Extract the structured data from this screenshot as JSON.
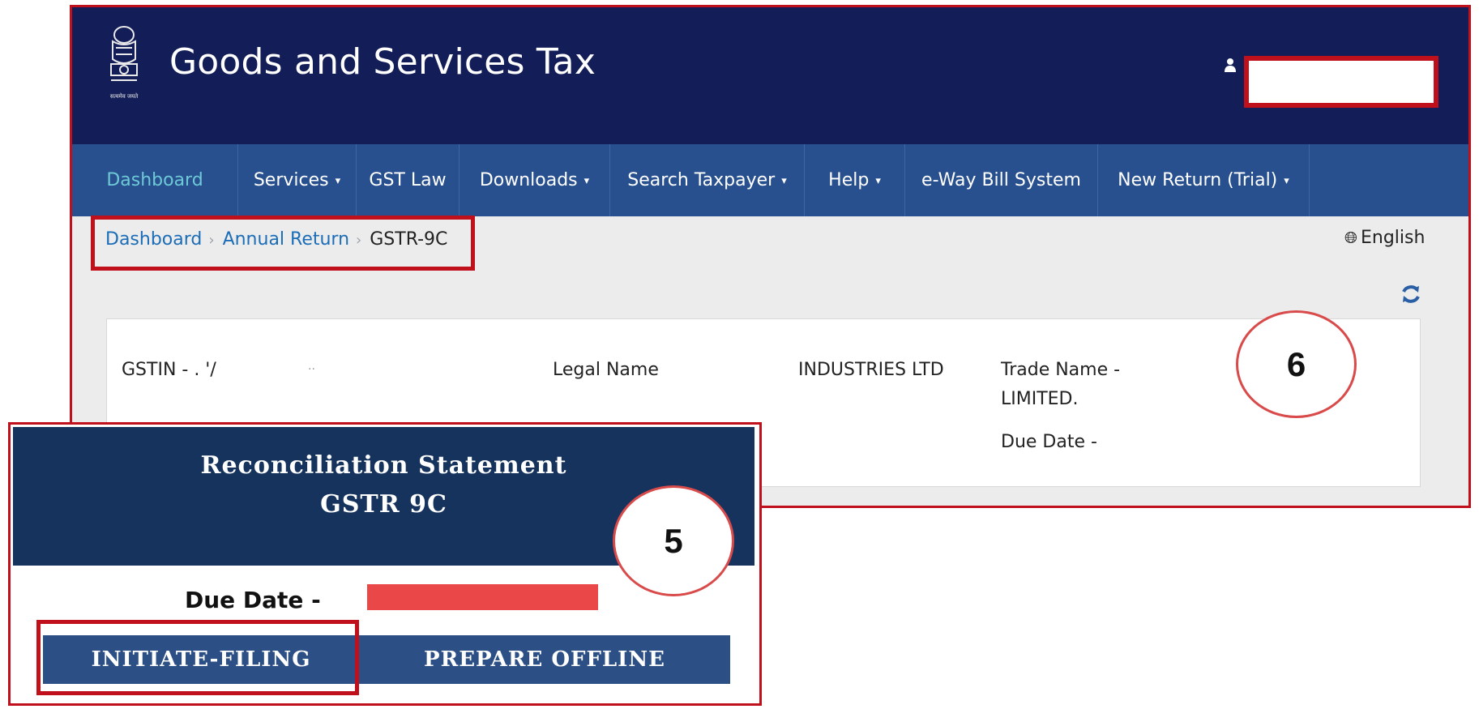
{
  "header": {
    "site_title": "Goods and Services Tax",
    "username": ""
  },
  "nav": {
    "items": [
      {
        "label": "Dashboard",
        "has_dropdown": false,
        "active": true
      },
      {
        "label": "Services",
        "has_dropdown": true
      },
      {
        "label": "GST Law",
        "has_dropdown": false
      },
      {
        "label": "Downloads",
        "has_dropdown": true
      },
      {
        "label": "Search Taxpayer",
        "has_dropdown": true
      },
      {
        "label": "Help",
        "has_dropdown": true
      },
      {
        "label": "e-Way Bill System",
        "has_dropdown": false
      },
      {
        "label": "New Return (Trial)",
        "has_dropdown": true
      }
    ],
    "caret": "▾"
  },
  "breadcrumb": {
    "items": [
      "Dashboard",
      "Annual Return",
      "GSTR-9C"
    ],
    "separator": "›"
  },
  "language": {
    "label": "English",
    "icon": "globe-icon"
  },
  "taxpayer": {
    "gstin": "GSTIN - . '/",
    "gstin_tail": "..",
    "legal_name_label": "Legal Name",
    "legal_name_value": "INDUSTRIES LTD",
    "trade_name_label": "Trade Name -",
    "trade_name_value": "LIMITED.",
    "due_date": "Due Date -"
  },
  "markers": {
    "top_right": "6",
    "overlay": "5"
  },
  "overlay": {
    "title_line1": "Reconciliation Statement",
    "title_line2": "GSTR 9C",
    "due_date_label": "Due Date -",
    "buttons": {
      "initiate": "INITIATE-FILING",
      "prepare": "PREPARE OFFLINE"
    }
  },
  "colors": {
    "header_bg": "#131d57",
    "nav_bg": "#28508f",
    "active_nav": "#6ec9d6",
    "highlight_red": "#c0101c",
    "overlay_header": "#15335c",
    "button_bg": "#2c4f86",
    "redaction": "#ea4848"
  }
}
